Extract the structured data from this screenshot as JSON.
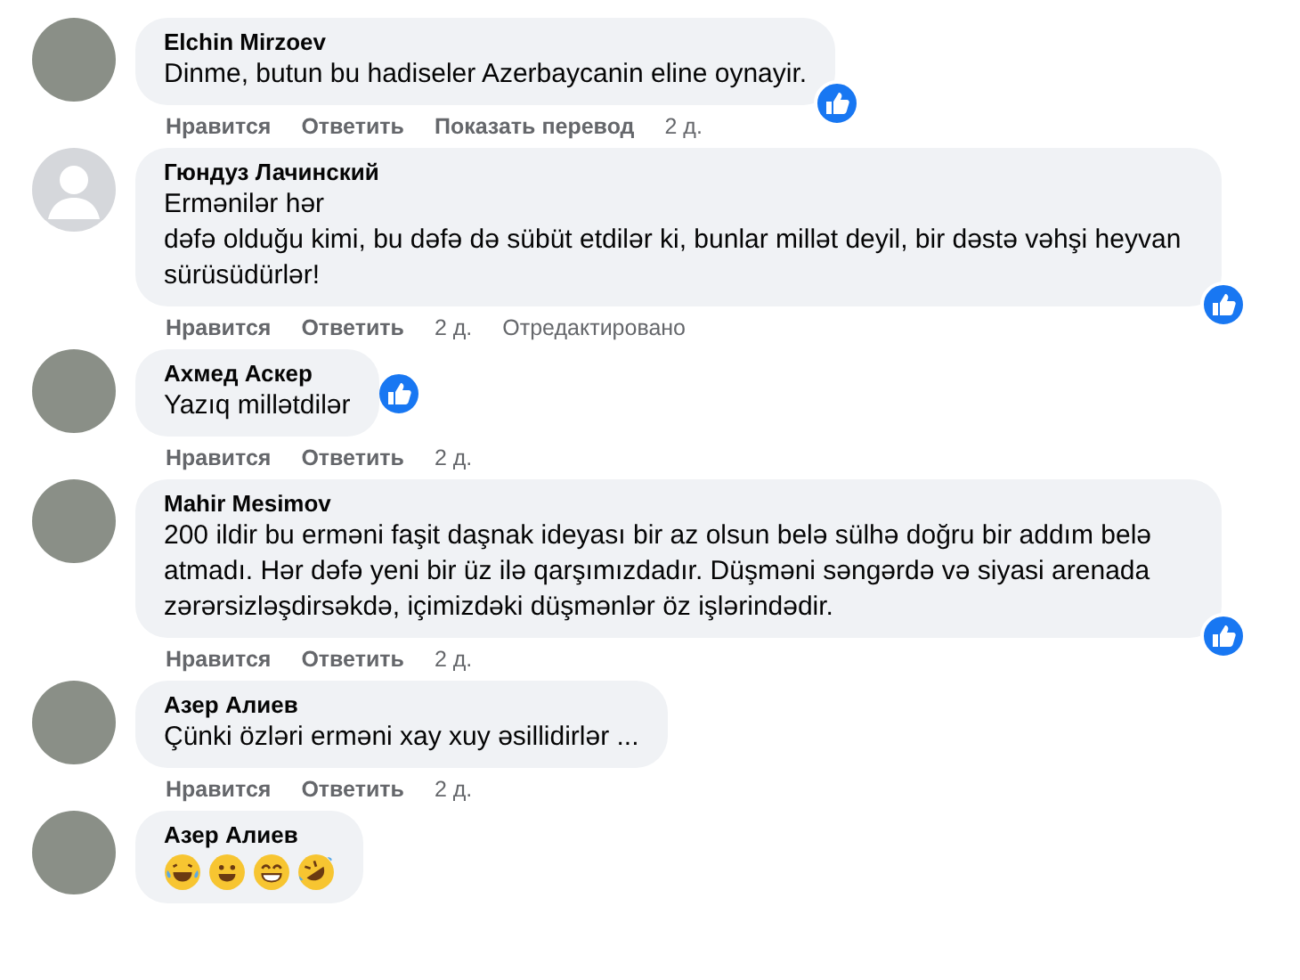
{
  "comments": [
    {
      "has_photo": true,
      "author": "Elchin Mirzoev",
      "text": "Dinme, butun bu hadiseler Azerbaycanin eline oynayir.",
      "reaction_badge": true,
      "actions": [
        {
          "text": "Нравится",
          "kind": "link"
        },
        {
          "text": "Ответить",
          "kind": "link"
        },
        {
          "text": "Показать перевод",
          "kind": "link"
        },
        {
          "text": "2 д.",
          "kind": "meta"
        }
      ]
    },
    {
      "has_photo": false,
      "author": "Гюндуз Лачинский",
      "text": "Ermənilər hər\ndəfə olduğu kimi, bu dəfə də sübüt etdilər ki, bunlar millət deyil, bir dəstə vəhşi heyvan sürüsüdürlər!",
      "reaction_badge": true,
      "actions": [
        {
          "text": "Нравится",
          "kind": "link"
        },
        {
          "text": "Ответить",
          "kind": "link"
        },
        {
          "text": "2 д.",
          "kind": "meta"
        },
        {
          "text": "Отредактировано",
          "kind": "meta"
        }
      ]
    },
    {
      "has_photo": true,
      "author": "Ахмед Аскер",
      "text": "Yazıq millətdilər",
      "reaction_badge": true,
      "actions": [
        {
          "text": "Нравится",
          "kind": "link"
        },
        {
          "text": "Ответить",
          "kind": "link"
        },
        {
          "text": "2 д.",
          "kind": "meta"
        }
      ]
    },
    {
      "has_photo": true,
      "author": "Mahir Mesimov",
      "text": "200 ildir bu erməni faşit daşnak ideyası bir az olsun belə sülhə doğru bir addım belə atmadı. Hər dəfə yeni bir üz ilə qarşımızdadır. Düşməni səngərdə və siyasi arenada zərərsizləşdirsəkdə, içimizdəki düşmənlər öz işlərindədir.",
      "reaction_badge": true,
      "actions": [
        {
          "text": "Нравится",
          "kind": "link"
        },
        {
          "text": "Ответить",
          "kind": "link"
        },
        {
          "text": "2 д.",
          "kind": "meta"
        }
      ]
    },
    {
      "has_photo": true,
      "author": "Азер Алиев",
      "text": "Çünki özləri erməni xay xuy əsillidirlər ...",
      "reaction_badge": false,
      "actions": [
        {
          "text": "Нравится",
          "kind": "link"
        },
        {
          "text": "Ответить",
          "kind": "link"
        },
        {
          "text": "2 д.",
          "kind": "meta"
        }
      ]
    },
    {
      "has_photo": true,
      "author": "Азер Алиев",
      "emojis": [
        {
          "kind": "tears"
        },
        {
          "kind": "smile"
        },
        {
          "kind": "grin"
        },
        {
          "kind": "rofl"
        }
      ],
      "reaction_badge": false
    }
  ]
}
